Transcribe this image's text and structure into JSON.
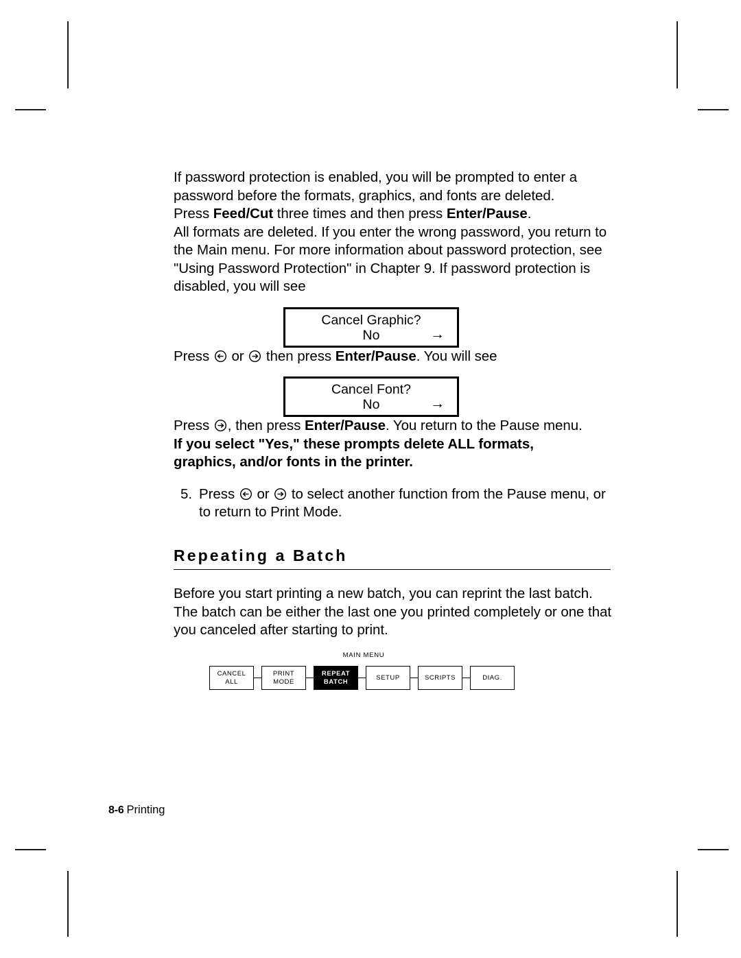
{
  "page": {
    "footer": {
      "folio": "8-6",
      "chapter_name": "Printing"
    }
  },
  "content": {
    "para_password_prompt": {
      "seg1": "If password protection is enabled, you will be prompted to enter a password before the formats, graphics, and fonts are deleted.  Press ",
      "bold1": "Feed/Cut",
      "seg2": " three times and then press ",
      "bold2": "Enter/Pause",
      "seg3": "."
    },
    "para_formats_deleted": "All formats are deleted.  If you enter the wrong password, you return to the Main menu.  For more information about password protection, see \"Using Password Protection\" in Chapter 9.  If password protection is disabled, you will see",
    "display_cancel_graphic": {
      "line1": "Cancel Graphic?",
      "line2": "No",
      "arrow": "→"
    },
    "para_press_arrows": {
      "seg1": "Press ",
      "icon1": "left-arrow-circle-icon",
      "seg2": " or ",
      "icon2": "right-arrow-circle-icon",
      "seg3": " then press ",
      "bold1": "Enter/Pause",
      "seg4": ".  You will see"
    },
    "display_cancel_font": {
      "line1": "Cancel Font?",
      "line2": "No",
      "arrow": "→"
    },
    "para_press_return": {
      "seg1": "Press ",
      "icon1": "right-arrow-circle-icon",
      "seg2": ", then press ",
      "bold1": "Enter/Pause",
      "seg3": ".  You return to the Pause menu.  ",
      "bold2": "If you select \"Yes,\" these prompts delete ALL formats, graphics, and/or fonts in the printer."
    },
    "step_5": {
      "number": "5.",
      "seg1": "Press ",
      "icon1": "left-arrow-circle-icon",
      "seg2": " or ",
      "icon2": "right-arrow-circle-icon",
      "seg3": " to select another function from the Pause menu, or to return to Print Mode."
    },
    "section_heading": "Repeating a Batch",
    "para_repeat_batch": "Before you start printing a new batch, you can reprint the last batch.  The batch can be either the last one you printed completely or one that you canceled after starting to print."
  },
  "menu_diagram": {
    "title": "MAIN MENU",
    "items": [
      {
        "line1": "CANCEL",
        "line2": "ALL",
        "selected": false
      },
      {
        "line1": "PRINT",
        "line2": "MODE",
        "selected": false
      },
      {
        "line1": "REPEAT",
        "line2": "BATCH",
        "selected": true
      },
      {
        "line1": "SETUP",
        "line2": "",
        "selected": false
      },
      {
        "line1": "SCRIPTS",
        "line2": "",
        "selected": false
      },
      {
        "line1": "DIAG.",
        "line2": "",
        "selected": false
      }
    ]
  },
  "colors": {
    "ink": "#000000",
    "paper": "#ffffff",
    "crop_mark": "#1a1a1a",
    "highlight_bg": "#000000",
    "highlight_fg": "#ffffff"
  }
}
